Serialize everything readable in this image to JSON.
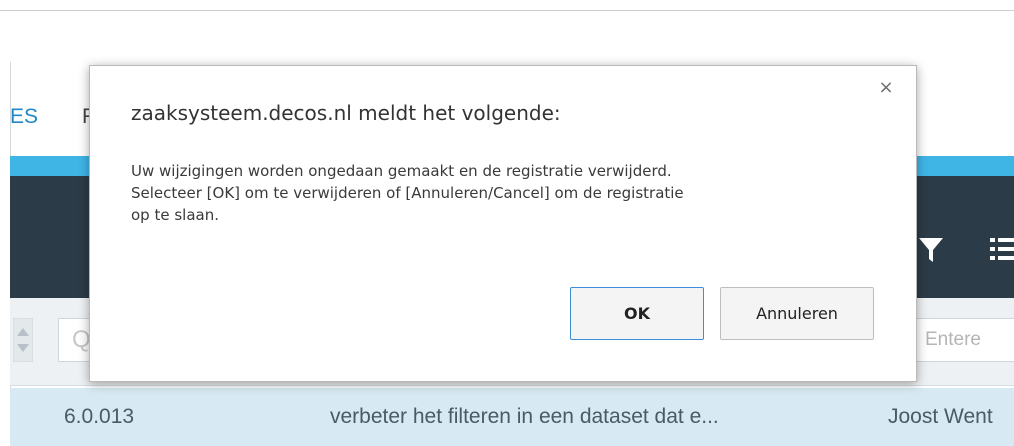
{
  "background": {
    "nav": {
      "item_1": "ES",
      "item_2": "F"
    },
    "filter_row": {
      "search_glyph": "Q",
      "enter_placeholder": "Entere"
    },
    "row": {
      "version": "6.0.013",
      "description": "verbeter het filteren in een dataset dat e...",
      "user": "Joost Went"
    },
    "colors": {
      "accent": "#3fb5e6",
      "toolbar": "#2c3b48",
      "row_highlight": "#d7eaf3",
      "link": "#1e88c8"
    },
    "icons": [
      "filter-icon",
      "list-icon",
      "sort-icon",
      "search-icon",
      "close-icon"
    ]
  },
  "dialog": {
    "title": "zaaksysteem.decos.nl meldt het volgende:",
    "message_lines": [
      "Uw wijzigingen worden ongedaan gemaakt en de registratie verwijderd.",
      "Selecteer [OK] om te verwijderen of [Annuleren/Cancel] om de registratie",
      "op te slaan."
    ],
    "close_symbol": "×",
    "ok_label": "OK",
    "cancel_label": "Annuleren"
  }
}
